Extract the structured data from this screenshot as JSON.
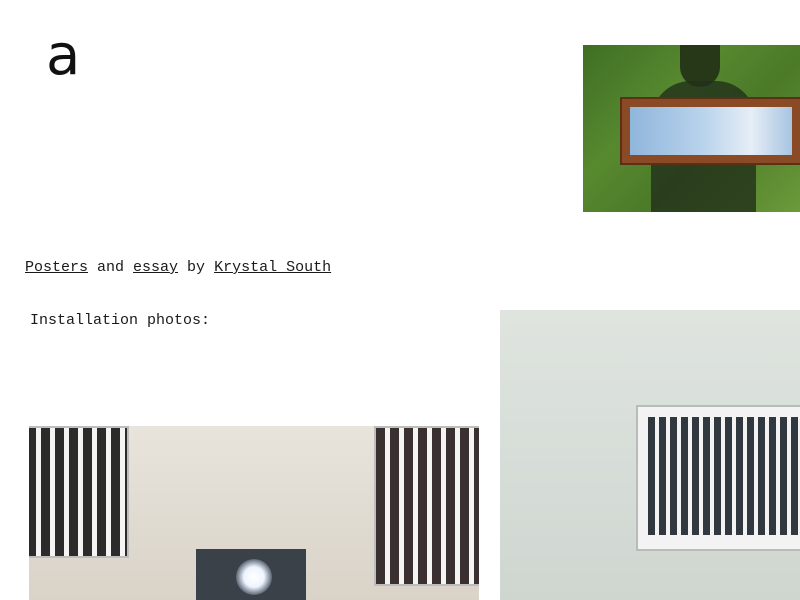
{
  "logo": {
    "text": "a"
  },
  "credit": {
    "posters_link": "Posters",
    "and_text": " and ",
    "essay_link": "essay",
    "by_text": " by ",
    "author_link": "Krystal South"
  },
  "installation": {
    "label": "Installation photos:"
  }
}
